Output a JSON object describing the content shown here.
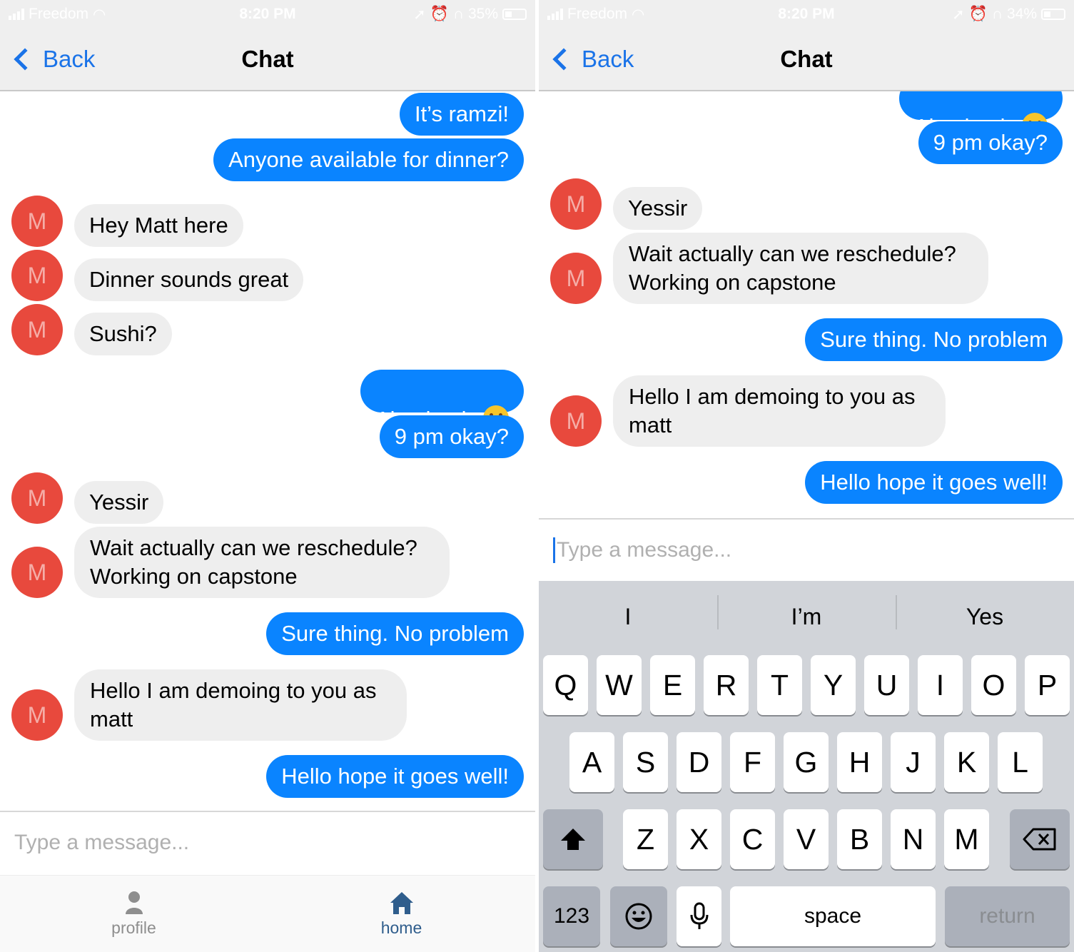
{
  "status_bar": {
    "left": {
      "carrier": "Freedom",
      "time": "8:20 PM",
      "battery": "35%"
    },
    "right": {
      "carrier": "Freedom",
      "time": "8:20 PM",
      "battery": "34%"
    }
  },
  "nav": {
    "back_label": "Back",
    "title": "Chat"
  },
  "avatar_initial": "M",
  "messages": {
    "ramzi": "It’s ramzi!",
    "dinner": "Anyone available for dinner?",
    "hey_matt": "Hey Matt here",
    "dinner_great": "Dinner sounds great",
    "sushi": "Sushi?",
    "absolutely": "Absolutely",
    "nine_pm": "9 pm okay?",
    "yessir": "Yessir",
    "reschedule": "Wait actually can we reschedule?\nWorking on capstone",
    "sure_thing": "Sure thing. No problem",
    "demoing": "Hello I am demoing to you as\nmatt",
    "hope_well": "Hello hope it goes well!"
  },
  "input": {
    "placeholder": "Type a message..."
  },
  "tab_bar": {
    "profile_label": "profile",
    "home_label": "home"
  },
  "keyboard": {
    "suggestions": [
      "I",
      "I’m",
      "Yes"
    ],
    "row1": [
      "Q",
      "W",
      "E",
      "R",
      "T",
      "Y",
      "U",
      "I",
      "O",
      "P"
    ],
    "row2": [
      "A",
      "S",
      "D",
      "F",
      "G",
      "H",
      "J",
      "K",
      "L"
    ],
    "row3": [
      "Z",
      "X",
      "C",
      "V",
      "B",
      "N",
      "M"
    ],
    "numbers_label": "123",
    "space_label": "space",
    "return_label": "return"
  },
  "colors": {
    "outgoing": "#0a84ff",
    "incoming": "#eeeeee",
    "avatar": "#e8493d",
    "link": "#1a73e8"
  }
}
